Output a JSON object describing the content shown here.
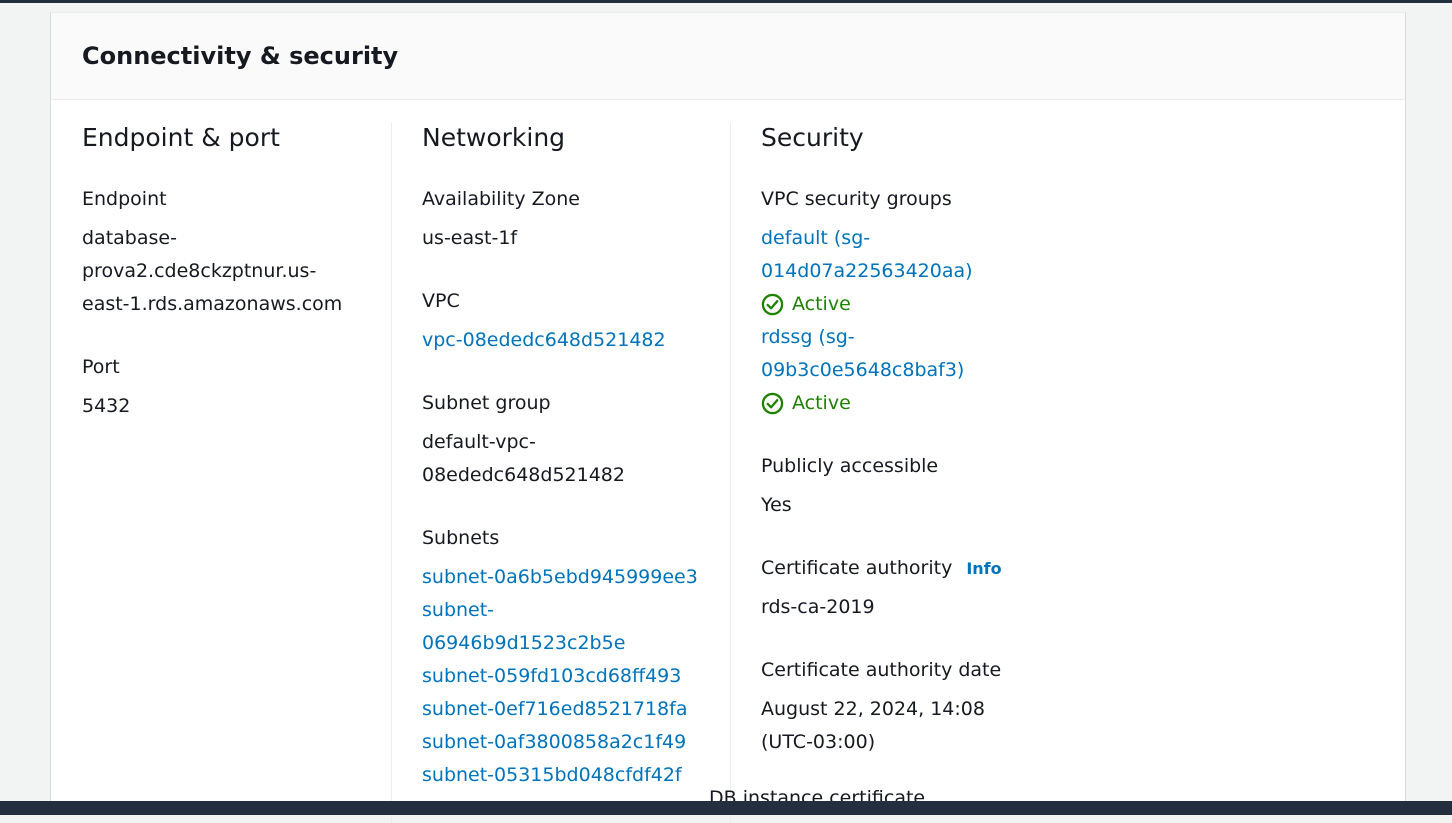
{
  "panel": {
    "title": "Connectivity & security"
  },
  "endpoint_port": {
    "title": "Endpoint & port",
    "endpoint_label": "Endpoint",
    "endpoint_lines": [
      "database-",
      "prova2.cde8ckzptnur.us-",
      "east-1.rds.amazonaws.com"
    ],
    "port_label": "Port",
    "port_value": "5432"
  },
  "networking": {
    "title": "Networking",
    "az_label": "Availability Zone",
    "az_value": "us-east-1f",
    "vpc_label": "VPC",
    "vpc_value": "vpc-08ededc648d521482",
    "subnet_group_label": "Subnet group",
    "subnet_group_lines": [
      "default-vpc-",
      "08ededc648d521482"
    ],
    "subnets_label": "Subnets",
    "subnets": [
      "subnet-0a6b5ebd945999ee3",
      "subnet-",
      "06946b9d1523c2b5e",
      "subnet-059fd103cd68ff493",
      "subnet-0ef716ed8521718fa",
      "subnet-0af3800858a2c1f49",
      "subnet-05315bd048cfdf42f"
    ]
  },
  "security": {
    "title": "Security",
    "vpc_sg_label": "VPC security groups",
    "sg1_lines": [
      "default (sg-",
      "014d07a22563420aa)"
    ],
    "sg1_status": "Active",
    "sg2_lines": [
      "rdssg (sg-",
      "09b3c0e5648c8baf3)"
    ],
    "sg2_status": "Active",
    "public_label": "Publicly accessible",
    "public_value": "Yes",
    "ca_label": "Certificate authority",
    "ca_info": "Info",
    "ca_value": "rds-ca-2019",
    "ca_date_label": "Certificate authority date",
    "ca_date_lines": [
      "August 22, 2024, 14:08",
      "(UTC-03:00)"
    ],
    "next_label_partial": "DB instance certificate"
  },
  "colors": {
    "link": "#0073bb",
    "success": "#1d8102",
    "text": "#16191f",
    "nav_bar": "#232f3e"
  },
  "icons": {
    "status": "check-circle-icon"
  }
}
